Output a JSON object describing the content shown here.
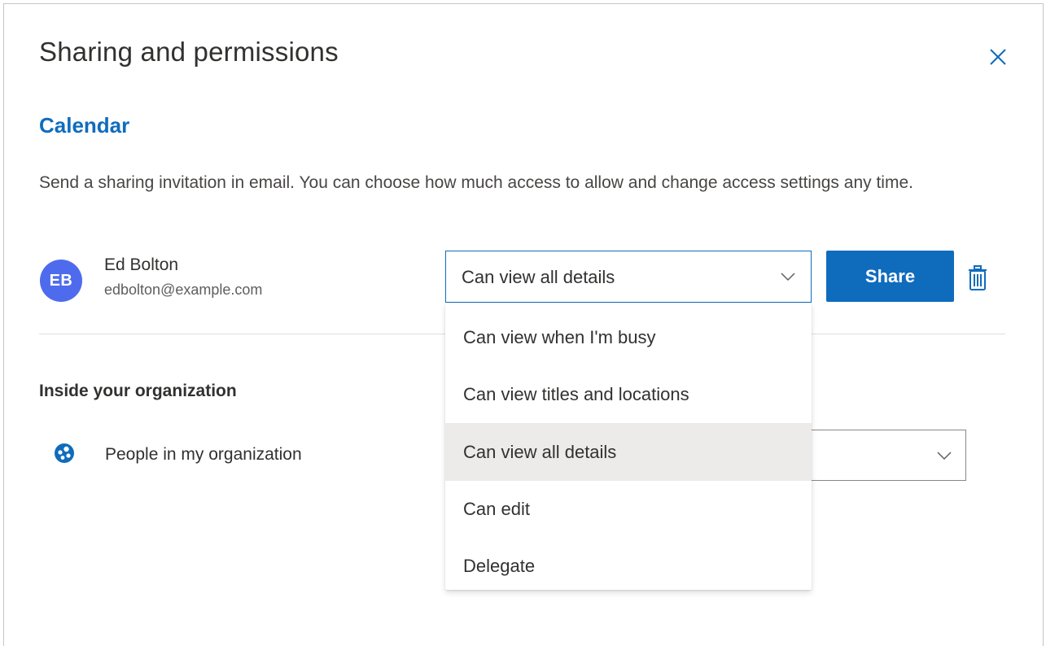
{
  "dialog": {
    "title": "Sharing and permissions",
    "close_icon": "close-icon"
  },
  "calendar": {
    "heading": "Calendar",
    "description": "Send a sharing invitation in email. You can choose how much access to allow and change access settings any time."
  },
  "recipient": {
    "initials": "EB",
    "name": "Ed Bolton",
    "email": "edbolton@example.com",
    "permission": "Can view all details",
    "share_label": "Share",
    "delete_icon": "trash-icon",
    "avatar_color": "#4f6bed"
  },
  "organization": {
    "heading": "Inside your organization",
    "label": "People in my organization",
    "icon": "people-org-icon",
    "permission": ""
  },
  "dropdown": {
    "options": [
      {
        "label": "Can view when I'm busy",
        "selected": false
      },
      {
        "label": "Can view titles and locations",
        "selected": false
      },
      {
        "label": "Can view all details",
        "selected": true
      },
      {
        "label": "Can edit",
        "selected": false
      },
      {
        "label": "Delegate",
        "selected": false
      }
    ]
  },
  "colors": {
    "accent": "#0f6cbd",
    "selected_option_bg": "#edebe9"
  }
}
